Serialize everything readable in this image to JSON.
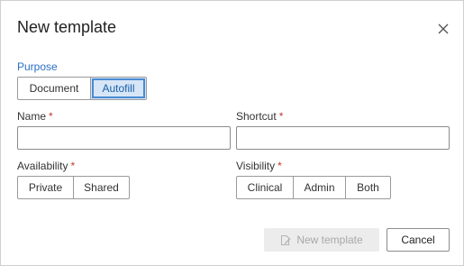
{
  "dialog": {
    "title": "New template",
    "close_icon": "close-icon"
  },
  "purpose": {
    "label": "Purpose",
    "options": [
      "Document",
      "Autofill"
    ],
    "selected": "Autofill"
  },
  "name": {
    "label": "Name",
    "required_mark": "*",
    "value": "",
    "placeholder": ""
  },
  "shortcut": {
    "label": "Shortcut",
    "required_mark": "*",
    "value": "",
    "placeholder": ""
  },
  "availability": {
    "label": "Availability",
    "required_mark": "*",
    "options": [
      "Private",
      "Shared"
    ]
  },
  "visibility": {
    "label": "Visibility",
    "required_mark": "*",
    "options": [
      "Clinical",
      "Admin",
      "Both"
    ]
  },
  "footer": {
    "submit_label": "New template",
    "submit_icon": "edit-document-icon",
    "submit_disabled": true,
    "cancel_label": "Cancel"
  },
  "colors": {
    "accent": "#2a6fc6",
    "selected_fill": "#d6e6f7",
    "required": "#c0392b"
  }
}
